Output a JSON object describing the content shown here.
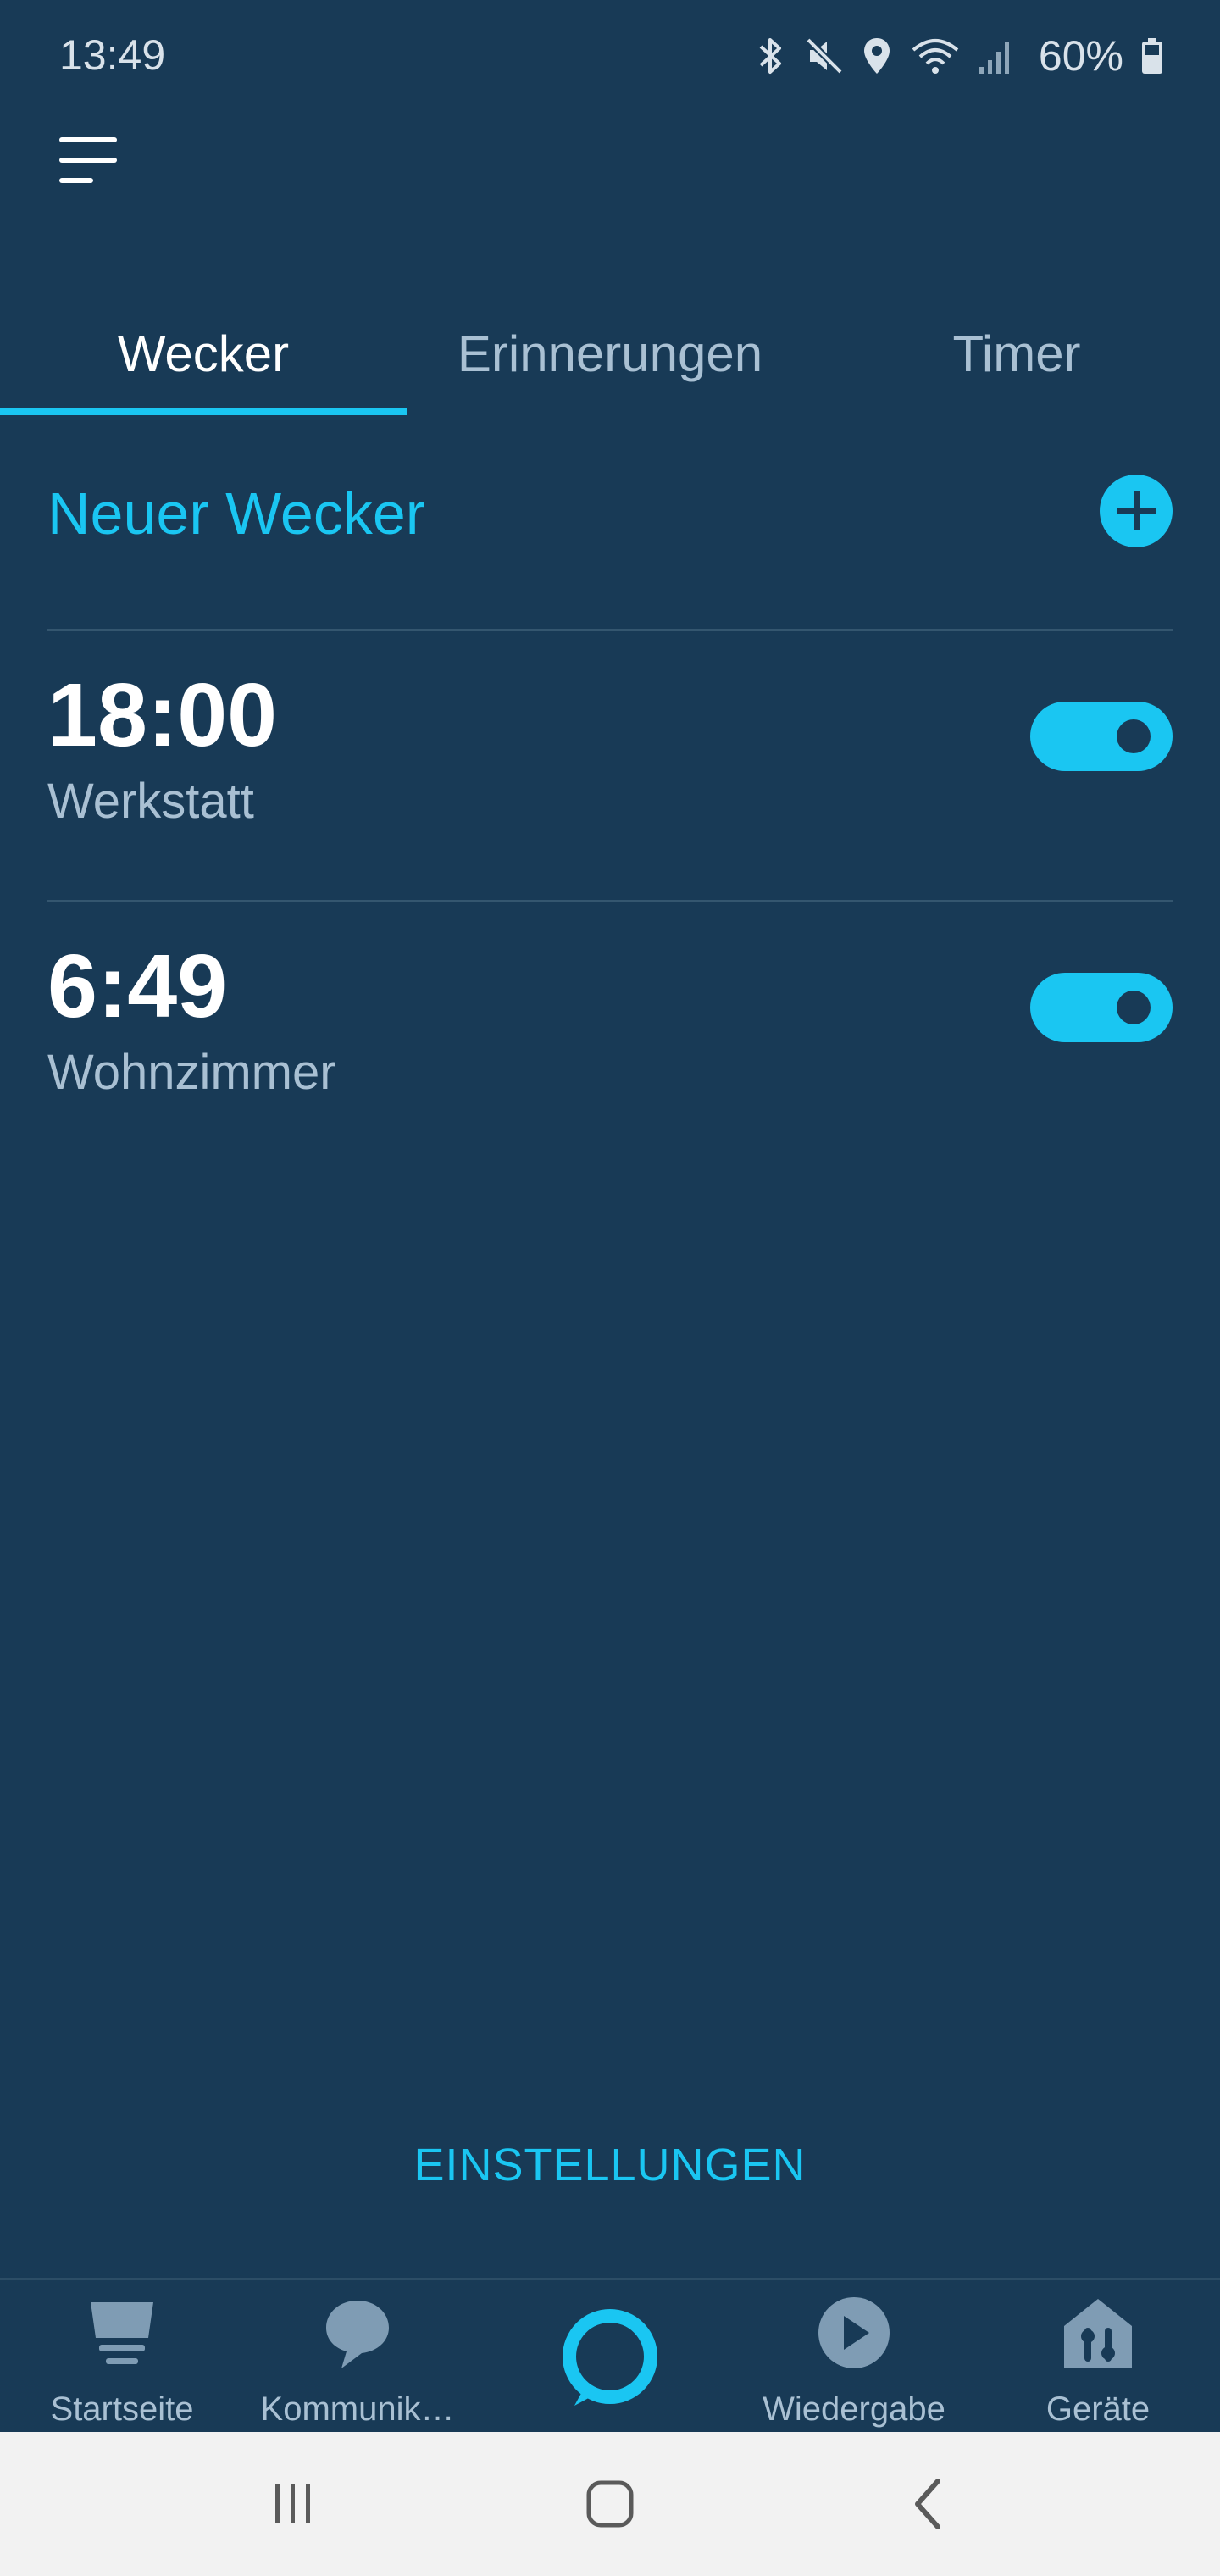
{
  "status_bar": {
    "time": "13:49",
    "battery": "60%",
    "icons": [
      "bluetooth-icon",
      "mute-icon",
      "location-icon",
      "wifi-icon",
      "signal-icon",
      "battery-icon"
    ]
  },
  "tabs": [
    {
      "label": "Wecker",
      "active": true
    },
    {
      "label": "Erinnerungen",
      "active": false
    },
    {
      "label": "Timer",
      "active": false
    }
  ],
  "new_alarm": {
    "label": "Neuer Wecker",
    "icon": "plus-icon"
  },
  "alarms": [
    {
      "time": "18:00",
      "room": "Werkstatt",
      "enabled": true
    },
    {
      "time": "6:49",
      "room": "Wohnzimmer",
      "enabled": true
    }
  ],
  "settings_label": "EINSTELLUNGEN",
  "bottom_nav": [
    {
      "label": "Startseite",
      "icon": "home-icon"
    },
    {
      "label": "Kommunik…",
      "icon": "chat-icon"
    },
    {
      "label": "",
      "icon": "alexa-icon"
    },
    {
      "label": "Wiedergabe",
      "icon": "play-icon"
    },
    {
      "label": "Geräte",
      "icon": "devices-icon"
    }
  ],
  "colors": {
    "background": "#183a56",
    "accent": "#1ac6f2",
    "muted_text": "#a9c0d3",
    "system_nav_bg": "#f2f2f2"
  }
}
